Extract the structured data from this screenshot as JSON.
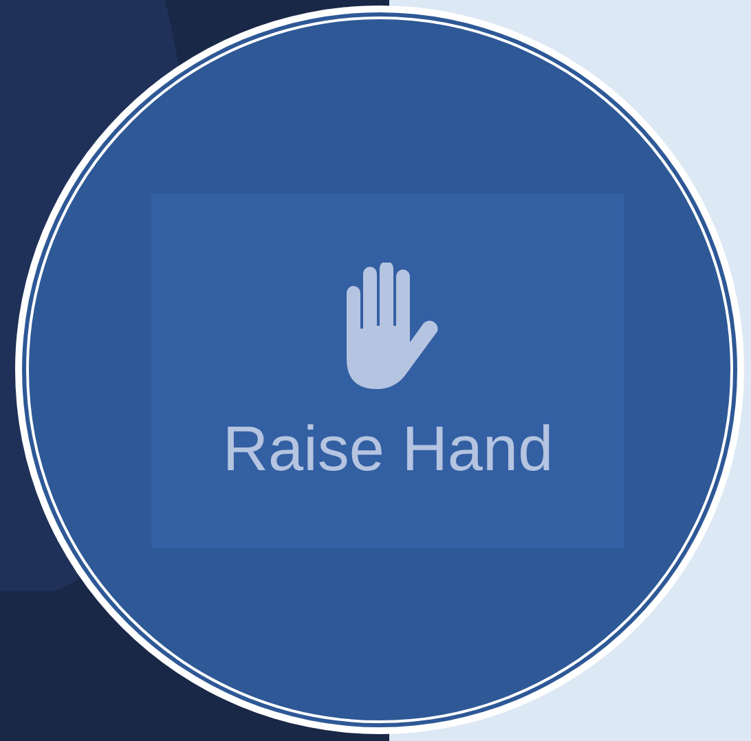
{
  "button": {
    "label": "Raise Hand"
  }
}
